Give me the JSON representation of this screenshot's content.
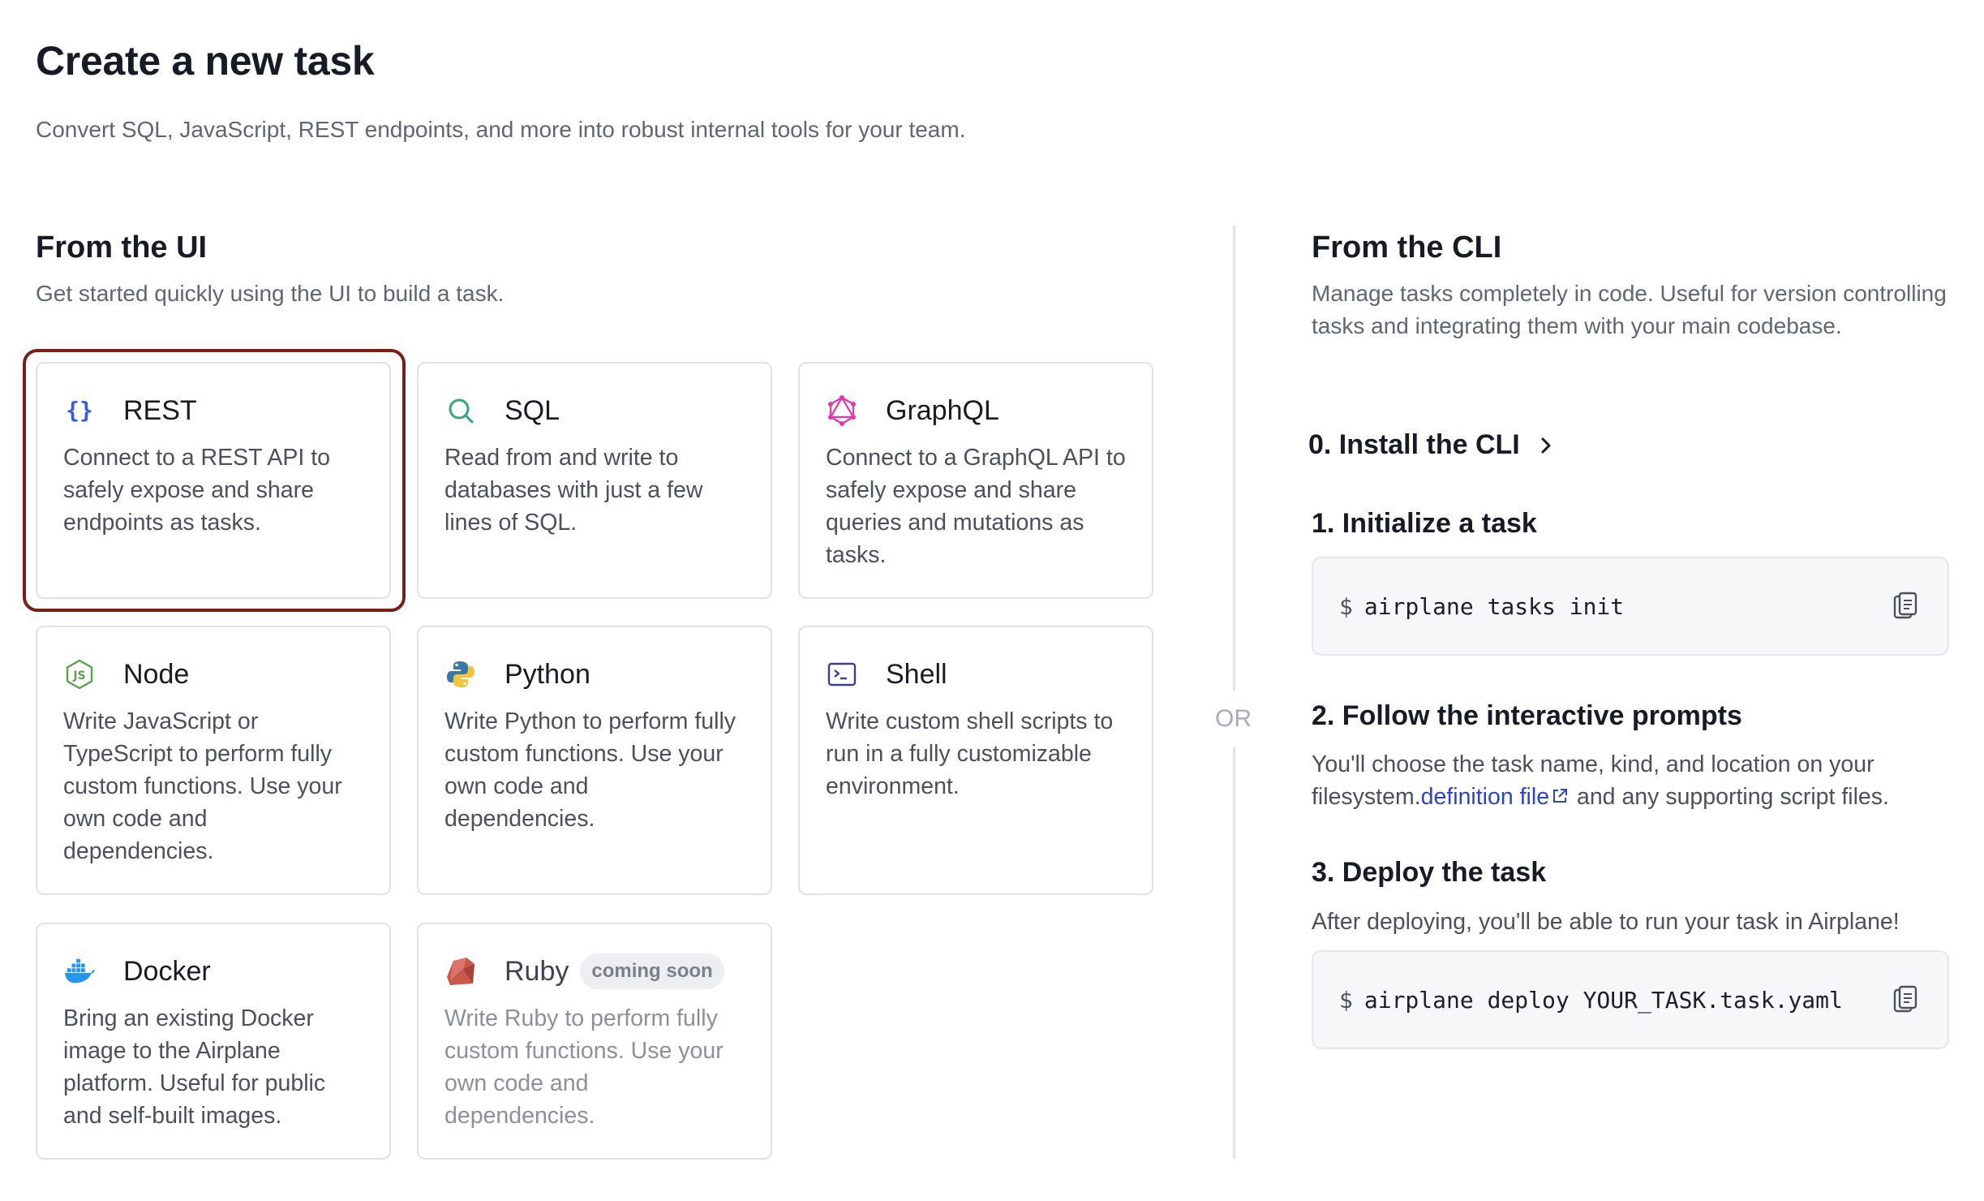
{
  "header": {
    "title": "Create a new task",
    "subtitle": "Convert SQL, JavaScript, REST endpoints, and more into robust internal tools for your team."
  },
  "ui_section": {
    "title": "From the UI",
    "description": "Get started quickly using the UI to build a task.",
    "cards": [
      {
        "title": "REST",
        "description": "Connect to a REST API to safely expose and share endpoints as tasks.",
        "icon": "braces-icon"
      },
      {
        "title": "SQL",
        "description": "Read from and write to databases with just a few lines of SQL.",
        "icon": "search-icon"
      },
      {
        "title": "GraphQL",
        "description": "Connect to a GraphQL API to safely expose and share queries and mutations as tasks.",
        "icon": "graphql-icon"
      },
      {
        "title": "Node",
        "description": "Write JavaScript or TypeScript to perform fully custom functions. Use your own code and dependencies.",
        "icon": "nodejs-icon"
      },
      {
        "title": "Python",
        "description": "Write Python to perform fully custom functions. Use your own code and dependencies.",
        "icon": "python-icon"
      },
      {
        "title": "Shell",
        "description": "Write custom shell scripts to run in a fully customizable environment.",
        "icon": "terminal-icon"
      },
      {
        "title": "Docker",
        "description": "Bring an existing Docker image to the Airplane platform. Useful for public and self-built images.",
        "icon": "docker-icon"
      },
      {
        "title": "Ruby",
        "badge": "coming soon",
        "description": "Write Ruby to perform fully custom functions. Use your own code and dependencies.",
        "icon": "ruby-icon"
      }
    ]
  },
  "divider": {
    "label": "OR"
  },
  "cli_section": {
    "title": "From the CLI",
    "description": "Manage tasks completely in code. Useful for version controlling tasks and integrating them with your main codebase.",
    "step0": {
      "title": "0. Install the CLI"
    },
    "step1": {
      "title": "1. Initialize a task",
      "prompt": "$",
      "command": "airplane tasks init"
    },
    "step2": {
      "title": "2. Follow the interactive prompts",
      "desc_before": "You'll choose the task name, kind, and location on your filesystem.",
      "link": "definition file",
      "desc_after": " and any supporting script files."
    },
    "step3": {
      "title": "3. Deploy the task",
      "description": "After deploying, you'll be able to run your task in Airplane!",
      "prompt": "$",
      "command": "airplane deploy YOUR_TASK.task.yaml"
    }
  },
  "colors": {
    "selected_outline": "#7a1f13",
    "link": "#2b45c7",
    "graphql": "#e535ab",
    "sql": "#3aa57a",
    "node": "#5fa04e",
    "docker": "#2496ed"
  }
}
